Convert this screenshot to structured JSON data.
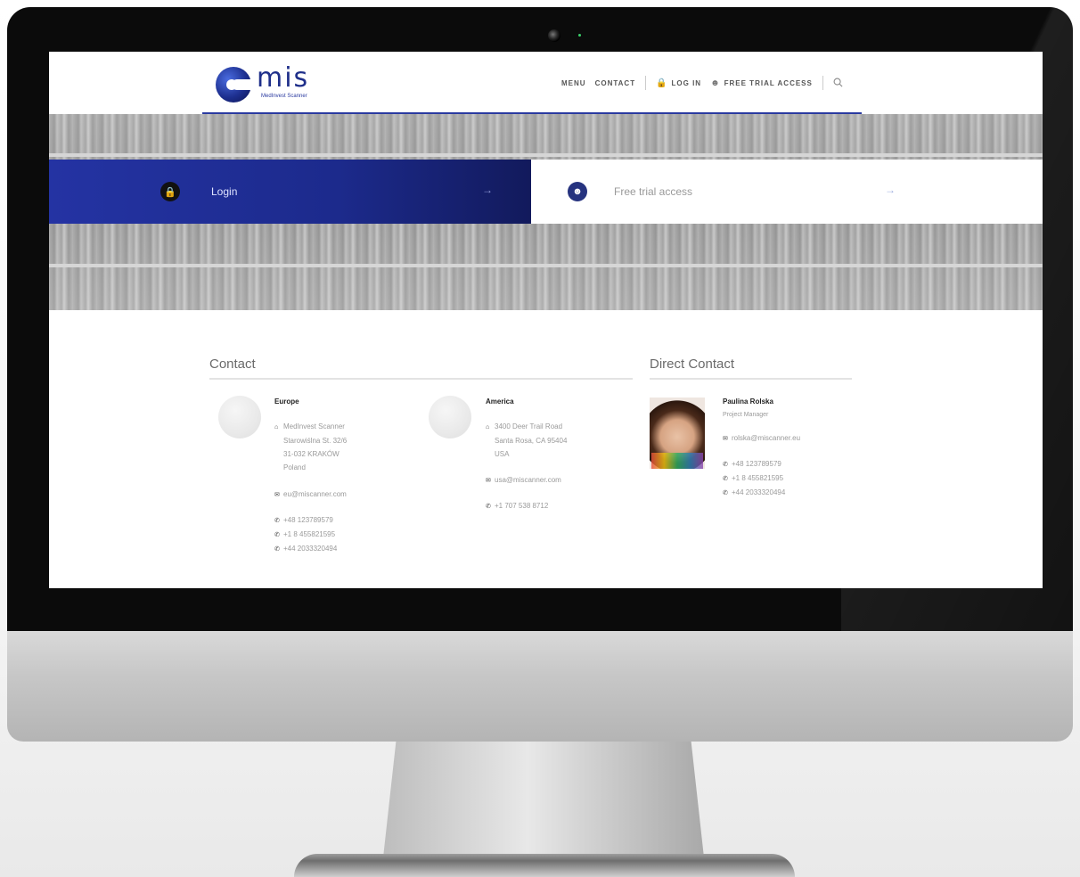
{
  "brand": {
    "name": "MIS",
    "logo_text": "mis",
    "sub": "MedInvest Scanner"
  },
  "nav": {
    "menu": "MENU",
    "contact": "CONTACT",
    "login": "LOG IN",
    "trial": "FREE TRIAL ACCESS"
  },
  "cta": {
    "login": "Login",
    "trial": "Free trial access",
    "arrow": "→"
  },
  "contact": {
    "title": "Contact",
    "europe": {
      "heading": "Europe",
      "address": [
        "MedInvest Scanner",
        "Starowiślna St. 32/6",
        "31-032 KRAKÓW",
        "Poland"
      ],
      "email": "eu@miscanner.com",
      "phones": [
        "+48 123789579",
        "+1 8 455821595",
        "+44 2033320494"
      ]
    },
    "america": {
      "heading": "America",
      "address": [
        "3400 Deer Trail Road",
        "Santa Rosa, CA 95404",
        "USA"
      ],
      "email": "usa@miscanner.com",
      "phones": [
        "+1 707 538 8712"
      ]
    }
  },
  "direct": {
    "title": "Direct Contact",
    "name": "Paulina Rolska",
    "role": "Project Manager",
    "email": "rolska@miscanner.eu",
    "phones": [
      "+48 123789579",
      "+1 8 455821595",
      "+44 2033320494"
    ]
  },
  "icons": {
    "home": "home-icon",
    "mail": "mail-icon",
    "phone": "phone-icon",
    "lock": "lock-icon",
    "user": "user-icon",
    "search": "search-icon"
  },
  "colors": {
    "brand": "#1f2f8a",
    "login_bg": "#2433a3"
  }
}
